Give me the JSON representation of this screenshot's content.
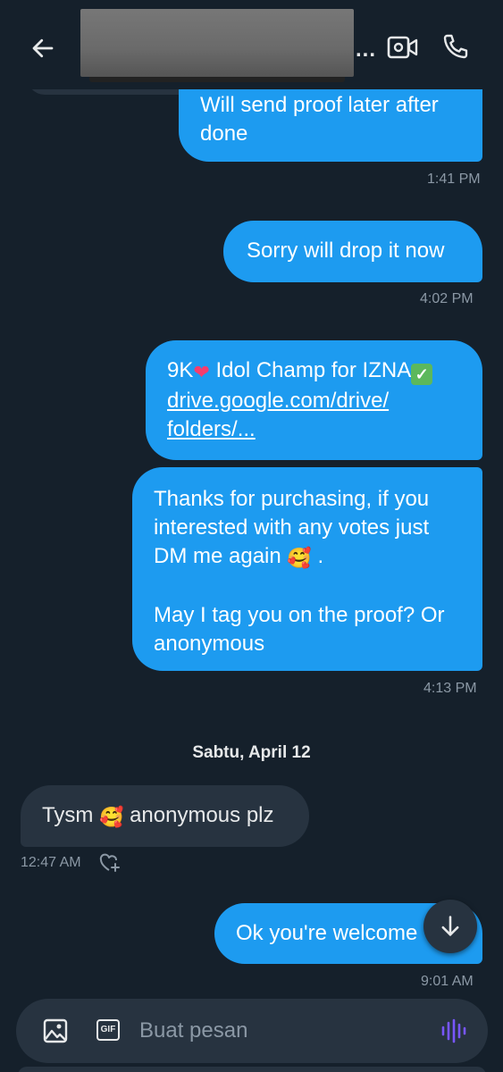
{
  "header": {
    "back_icon": "arrow-left-icon",
    "ellipsis": "...",
    "video_icon": "video-call-icon",
    "call_icon": "phone-icon"
  },
  "messages": [
    {
      "direction": "out",
      "text": "Will send proof later after done",
      "time": "1:41 PM"
    },
    {
      "direction": "out",
      "text": "Sorry will drop it now",
      "time": "4:02 PM"
    },
    {
      "direction": "out",
      "text_prefix": "9K",
      "text_mid": " Idol Champ for IZNA",
      "link": "drive.google.com/drive/folders/...",
      "link_line1": "drive.google.com/drive/",
      "link_line2": "folders/..."
    },
    {
      "direction": "out",
      "line1": "Thanks for purchasing,  if you",
      "line2": "interested with any votes just",
      "line3": "DM me again",
      "line3_tail": " .",
      "line4": "May I tag you on the proof? Or",
      "line5": "anonymous",
      "time": "4:13 PM"
    },
    {
      "direction": "in",
      "text_before": "Tysm",
      "text_after": " anonymous plz",
      "time": "12:47 AM"
    },
    {
      "direction": "out",
      "text": "Ok you're welcome",
      "time": "9:01 AM"
    }
  ],
  "date_separator": "Sabtu, April 12",
  "composer": {
    "placeholder": "Buat pesan",
    "gif_label": "GIF"
  },
  "colors": {
    "background": "#15202b",
    "outgoing_bubble": "#1d9bf0",
    "incoming_bubble": "#273340",
    "timestamp": "#8b98a5",
    "voice_accent": "#7856ff"
  }
}
